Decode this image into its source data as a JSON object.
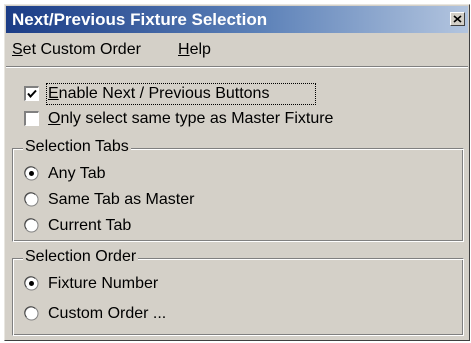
{
  "window": {
    "title": "Next/Previous Fixture Selection"
  },
  "menu": {
    "items": [
      {
        "label": "Set Custom Order",
        "mnemonic": "S"
      },
      {
        "label": "Help",
        "mnemonic": "H"
      }
    ]
  },
  "options": {
    "enable_buttons": {
      "label": "Enable Next / Previous Buttons",
      "mnemonic": "E",
      "checked": true
    },
    "same_type": {
      "label": "Only select same type as Master Fixture",
      "mnemonic": "O",
      "checked": false
    }
  },
  "selection_tabs": {
    "title": "Selection Tabs",
    "options": [
      {
        "label": "Any Tab",
        "selected": true
      },
      {
        "label": "Same Tab as Master",
        "selected": false
      },
      {
        "label": "Current Tab",
        "selected": false
      }
    ]
  },
  "selection_order": {
    "title": "Selection Order",
    "options": [
      {
        "label": "Fixture Number",
        "selected": true
      },
      {
        "label": "Custom Order ...",
        "selected": false
      }
    ]
  },
  "colors": {
    "face": "#d4d0c8",
    "title_start": "#1b3c86",
    "title_end": "#b3c5df"
  },
  "icons": {
    "close": "close-icon",
    "check": "check-icon",
    "radio_dot": "radio-dot-icon"
  }
}
